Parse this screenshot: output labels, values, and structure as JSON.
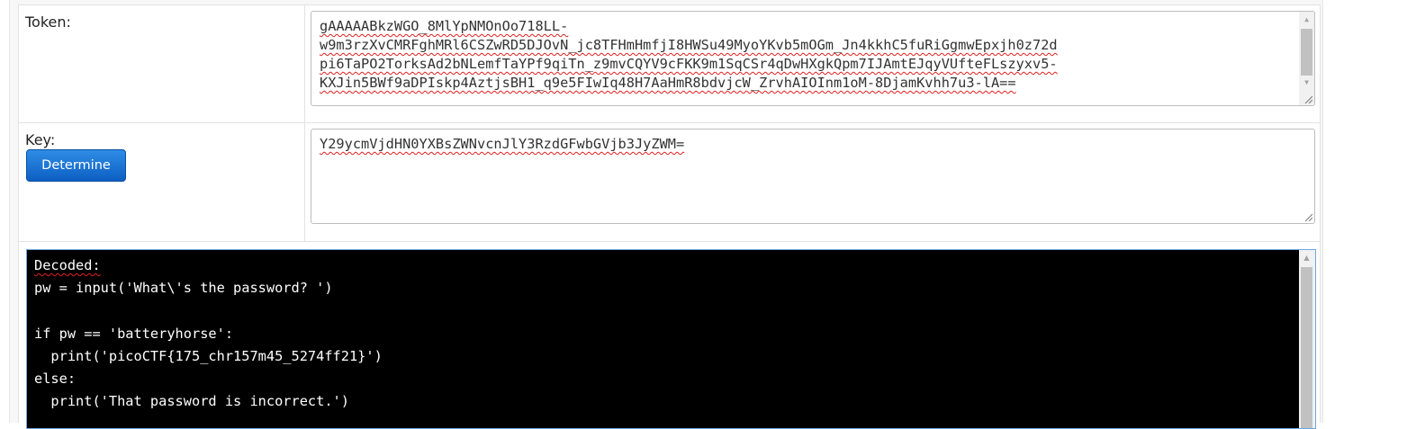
{
  "token": {
    "label": "Token:",
    "lines": [
      "gAAAAABkzWGO_8MlYpNMOnOo718LL-",
      "w9m3rzXvCMRFghMRl6CSZwRD5DJOvN_jc8TFHmHmfjI8HWSu49MyoYKvb5mOGm_Jn4kkhC5fuRiGgmwEpxjh0z72d",
      "pi6TaPO2TorksAd2bNLemfTaYPf9qiTn_z9mvCQYV9cFKK9m1SqCSr4qDwHXgkQpm7IJAmtEJqyVUfteFLszyxv5-",
      "KXJin5BWf9aDPIskp4AztjsBH1_q9e5FIwIq48H7AaHmR8bdvjcW_ZrvhAIOInm1oM-8DjamKvhh7u3-lA=="
    ]
  },
  "key": {
    "label": "Key:",
    "value": "Y29ycmVjdHN0YXBsZWNvcnJlY3RzdGFwbGVjb3JyZWM=",
    "button_label": "Determine"
  },
  "output": {
    "lines": [
      "Decoded:",
      "pw = input('What\\'s the password? ')",
      "",
      "if pw == 'batteryhorse':",
      "  print('picoCTF{175_chr157m45_5274ff21}')",
      "else:",
      "  print('That password is incorrect.')"
    ]
  },
  "colors": {
    "button": "#1a6fd4",
    "spellcheck": "#e02020",
    "output_bg": "#000000",
    "output_fg": "#ffffff"
  },
  "icons": [
    "scroll-up-arrow-icon",
    "scroll-down-arrow-icon",
    "resize-grip-icon"
  ]
}
